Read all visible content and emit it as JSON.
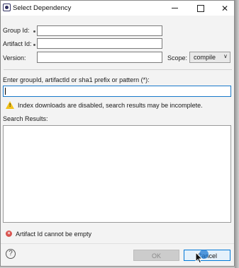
{
  "window": {
    "title": "Select Dependency",
    "controls": {
      "minimize": "minimize-icon",
      "maximize": "maximize-icon",
      "close": "close-icon"
    }
  },
  "form": {
    "group_id": {
      "label": "Group Id:",
      "value": ""
    },
    "artifact_id": {
      "label": "Artifact Id:",
      "value": ""
    },
    "version": {
      "label": "Version:",
      "value": ""
    },
    "scope": {
      "label": "Scope:",
      "selected": "compile"
    }
  },
  "search": {
    "label": "Enter groupId, artifactId or sha1 prefix or pattern (*):",
    "value": "",
    "warning": "Index downloads are disabled, search results may be incomplete.",
    "results_label": "Search Results:",
    "results": []
  },
  "status": {
    "error_message": "Artifact Id cannot be empty"
  },
  "buttons": {
    "ok": "OK",
    "cancel": "Cancel"
  },
  "colors": {
    "window_bg": "#f3f3f3",
    "focus_border": "#1979ca",
    "warning": "#f2c21b",
    "error": "#d9534f",
    "default_button_border": "#0078d7"
  }
}
